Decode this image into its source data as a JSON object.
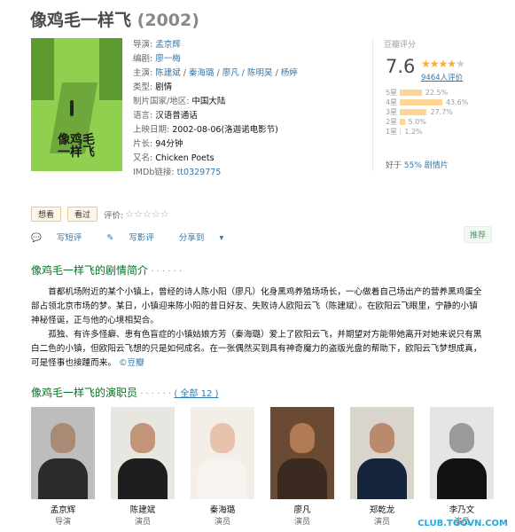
{
  "title": {
    "name": "像鸡毛一样飞",
    "year": "(2002)"
  },
  "poster": {
    "title_line1": "像鸡毛",
    "title_line2": "一样飞"
  },
  "info": {
    "director_label": "导演: ",
    "director": "孟京辉",
    "writer_label": "编剧: ",
    "writer": "廖一梅",
    "cast_label": "主演: ",
    "cast": [
      "陈建斌",
      "秦海璐",
      "廖凡",
      "陈明昊",
      "杨婷"
    ],
    "sep": " / ",
    "genre_label": "类型: ",
    "genre": "剧情",
    "country_label": "制片国家/地区: ",
    "country": "中国大陆",
    "language_label": "语言: ",
    "language": "汉语普通话",
    "release_label": "上映日期: ",
    "release": "2002-08-06(洛迦诺电影节)",
    "runtime_label": "片长: ",
    "runtime": "94分钟",
    "aka_label": "又名: ",
    "aka": "Chicken Poets",
    "imdb_label": "IMDb链接: ",
    "imdb": "tt0329775"
  },
  "rating": {
    "header": "豆瓣评分",
    "score": "7.6",
    "stars_filled": 4,
    "votes": "9464人评价",
    "distribution": [
      {
        "label": "5星",
        "percent": "22.5%",
        "value": 22.5
      },
      {
        "label": "4星",
        "percent": "43.6%",
        "value": 43.6
      },
      {
        "label": "3星",
        "percent": "27.7%",
        "value": 27.7
      },
      {
        "label": "2星",
        "percent": "5.0%",
        "value": 5.0
      },
      {
        "label": "1星",
        "percent": "1.2%",
        "value": 1.2
      }
    ],
    "better_prefix": "好于 ",
    "better_percent": "55%",
    "better_genre": " 剧情片"
  },
  "actions": {
    "want": "想看",
    "watched": "看过",
    "rate_label": "评价:",
    "write_short": "写短评",
    "write_review": "写影评",
    "share": "分享到",
    "recommend": "推荐"
  },
  "synopsis": {
    "heading": "像鸡毛一样飞的剧情简介",
    "dots": " · · · · · ·",
    "p1": "首都机场附近的某个小镇上，曾经的诗人陈小阳（廖凡）化身黑鸡养殖场场长，一心做着自己场出产的营养黑鸡蛋全部占领北京市场的梦。某日，小镇迎来陈小阳的昔日好友、失败诗人欧阳云飞（陈建斌）。在欧阳云飞眼里，宁静的小镇神秘怪诞，正与他的心境相契合。",
    "p2": "孤独、有许多怪癖、患有色盲症的小镇姑娘方芳（秦海璐）爱上了欧阳云飞，并期望对方能带她离开对她来说只有黑白二色的小镇，但欧阳云飞想的只是如何成名。在一张偶然买到具有神奇魔力的盗版光盘的帮助下，欧阳云飞梦想成真，可是怪事也接踵而来。",
    "source": "©豆瓣"
  },
  "cast_section": {
    "heading": "像鸡毛一样飞的演职员",
    "dots": " · · · · · · ",
    "all": "( 全部 12 )",
    "members": [
      {
        "name": "孟京辉",
        "role": "导演"
      },
      {
        "name": "陈建斌",
        "role": "演员"
      },
      {
        "name": "秦海璐",
        "role": "演员"
      },
      {
        "name": "廖凡",
        "role": "演员"
      },
      {
        "name": "郑乾龙",
        "role": "演员"
      },
      {
        "name": "李乃文",
        "role": "演员"
      }
    ]
  },
  "watermark": "CLUB.TGOVN.COM"
}
